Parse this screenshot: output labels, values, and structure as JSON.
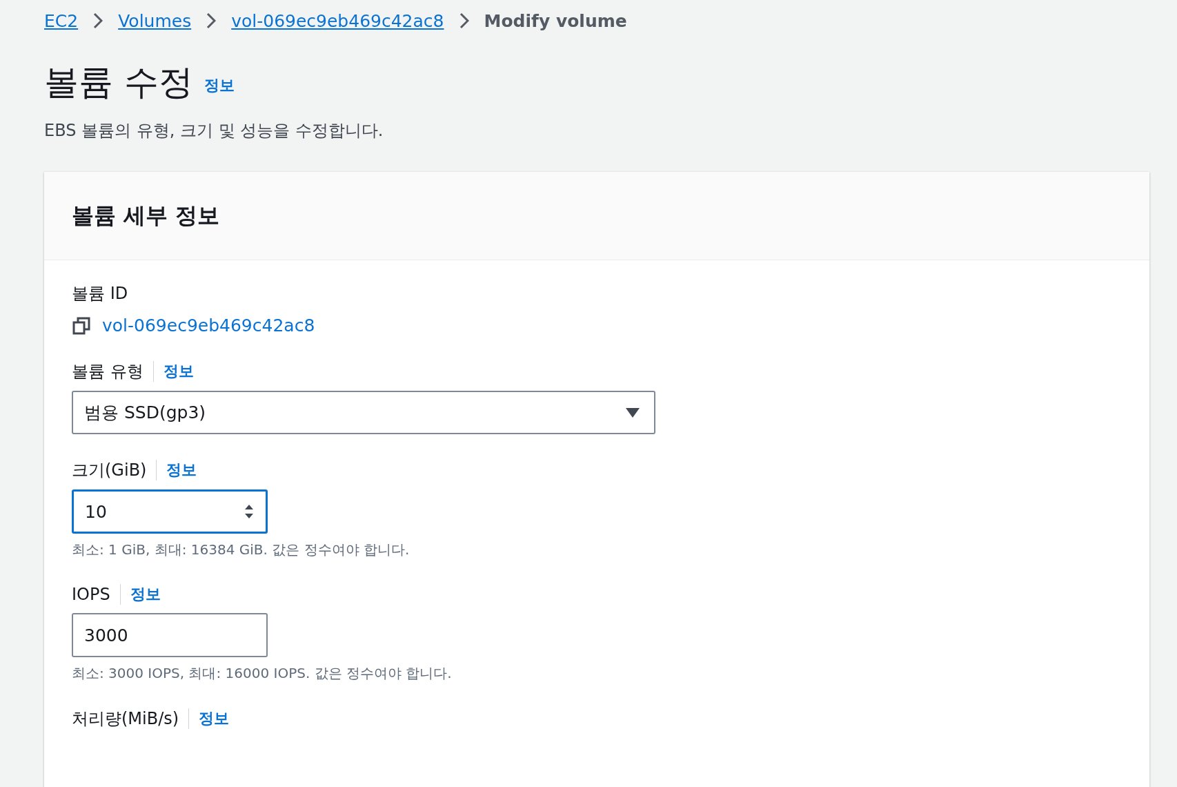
{
  "breadcrumbs": [
    {
      "label": "EC2",
      "kind": "link"
    },
    {
      "label": "Volumes",
      "kind": "link"
    },
    {
      "label": "vol-069ec9eb469c42ac8",
      "kind": "link"
    },
    {
      "label": "Modify volume",
      "kind": "current"
    }
  ],
  "page": {
    "title": "볼륨 수정",
    "info": "정보",
    "description": "EBS 볼륨의 유형, 크기 및 성능을 수정합니다."
  },
  "panel": {
    "title": "볼륨 세부 정보",
    "fields": [
      {
        "kind": "copy",
        "label": "볼륨 ID",
        "value": "vol-069ec9eb469c42ac8"
      },
      {
        "kind": "select",
        "label": "볼륨 유형",
        "info": "정보",
        "value": "범용 SSD(gp3)"
      },
      {
        "kind": "number",
        "label": "크기(GiB)",
        "info": "정보",
        "value": "10",
        "focused": true,
        "hint": "최소: 1 GiB, 최대: 16384 GiB. 값은 정수여야 합니다."
      },
      {
        "kind": "text",
        "label": "IOPS",
        "info": "정보",
        "value": "3000",
        "focused": false,
        "hint": "최소: 3000 IOPS, 최대: 16000 IOPS. 값은 정수여야 합니다."
      },
      {
        "kind": "text",
        "label": "처리량(MiB/s)",
        "info": "정보"
      }
    ]
  }
}
